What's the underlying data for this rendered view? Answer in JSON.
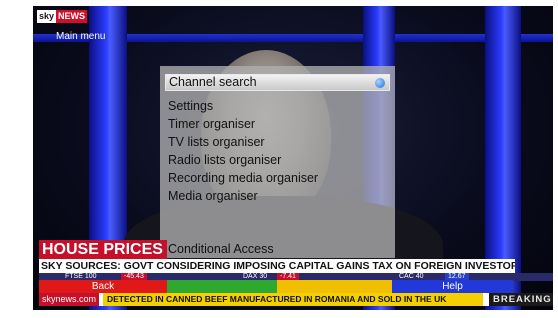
{
  "channel": {
    "logo_sky": "sky",
    "logo_news": "NEWS"
  },
  "menu": {
    "title": "Main menu",
    "items": [
      "Channel search",
      "Settings",
      "Timer organiser",
      "TV lists organiser",
      "Radio lists organiser",
      "Recording media organiser",
      "Media organiser",
      "Conditional Access"
    ],
    "selected_index": 0
  },
  "lower_third": {
    "banner": "HOUSE PRICES",
    "headline": "SKY SOURCES: GOVT CONSIDERING IMPOSING CAPITAL GAINS TAX ON FOREIGN INVESTORS",
    "ticker": [
      {
        "name": "FTSE 100",
        "value": "-45.43"
      },
      {
        "name": "DAX 30",
        "value": "-7.41"
      },
      {
        "name": "CAC 40",
        "value": "12.67"
      }
    ],
    "website": "skynews.com",
    "crawl": "DETECTED IN CANNED BEEF MANUFACTURED IN ROMANIA AND SOLD IN THE UK",
    "breaking": "BREAKING N"
  },
  "buttons": {
    "back": "Back",
    "help": "Help",
    "colors": {
      "red": "#e01818",
      "green": "#2fa82f",
      "yellow": "#f0c000",
      "blue": "#2238d8"
    }
  }
}
